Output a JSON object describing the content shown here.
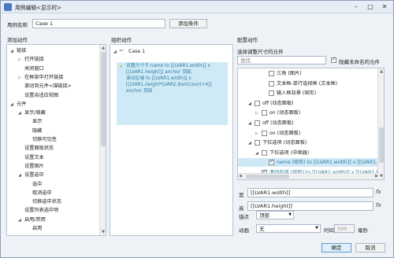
{
  "window": {
    "title": "用例编辑<显示时>",
    "min_glyph": "–",
    "max_glyph": "□",
    "close_glyph": "✕"
  },
  "top": {
    "case_name_label": "用例名称",
    "case_name_value": "Case 1",
    "add_condition_label": "添加条件"
  },
  "left": {
    "title": "添加动作",
    "items": [
      {
        "label": "链接",
        "indent": 0,
        "twisty": "◢"
      },
      {
        "label": "打开链接",
        "indent": 1,
        "twisty": "▷"
      },
      {
        "label": "关闭窗口",
        "indent": 1,
        "twisty": ""
      },
      {
        "label": "在框架中打开链接",
        "indent": 1,
        "twisty": "▷"
      },
      {
        "label": "滚动到元件<锚链接>",
        "indent": 1,
        "twisty": ""
      },
      {
        "label": "设置自适应视图",
        "indent": 1,
        "twisty": ""
      },
      {
        "label": "元件",
        "indent": 0,
        "twisty": "◢"
      },
      {
        "label": "显示/隐藏",
        "indent": 1,
        "twisty": "◢"
      },
      {
        "label": "显示",
        "indent": 2,
        "twisty": ""
      },
      {
        "label": "隐藏",
        "indent": 2,
        "twisty": ""
      },
      {
        "label": "切换可见性",
        "indent": 2,
        "twisty": ""
      },
      {
        "label": "设置面板状态",
        "indent": 1,
        "twisty": ""
      },
      {
        "label": "设置文本",
        "indent": 1,
        "twisty": ""
      },
      {
        "label": "设置图片",
        "indent": 1,
        "twisty": ""
      },
      {
        "label": "设置选中",
        "indent": 1,
        "twisty": "◢"
      },
      {
        "label": "选中",
        "indent": 2,
        "twisty": ""
      },
      {
        "label": "取消选中",
        "indent": 2,
        "twisty": ""
      },
      {
        "label": "切换选中状态",
        "indent": 2,
        "twisty": ""
      },
      {
        "label": "设置列表选中项",
        "indent": 1,
        "twisty": ""
      },
      {
        "label": "启用/禁用",
        "indent": 1,
        "twisty": "◢"
      },
      {
        "label": "启用",
        "indent": 2,
        "twisty": ""
      }
    ]
  },
  "middle": {
    "title": "组织动作",
    "case_label": "Case 1",
    "action_lines": [
      "设置尺寸于 name to [[LVAR1.width]] x",
      "[[LVAR1.height]] anchor 顶部,",
      "滚动区域 to [[LVAR1.width]] x",
      "[[LVAR1.height*LVAR2.itemCount+4]]",
      "anchor 顶部"
    ]
  },
  "right": {
    "title": "配置动作",
    "subtitle": "选择调整尺寸的元件",
    "search_placeholder": "查找",
    "hide_unnamed_label": "隐藏未命名的元件",
    "hide_unnamed_checked": true,
    "tree": [
      {
        "label": "三角 (图片)",
        "indent": 3,
        "twisty": "",
        "checked": false,
        "highlight": false
      },
      {
        "label": "文本框-单行选择框 (文本框)",
        "indent": 3,
        "twisty": "",
        "checked": false,
        "highlight": false
      },
      {
        "label": "输入框背景 (矩形)",
        "indent": 3,
        "twisty": "",
        "checked": false,
        "highlight": false
      },
      {
        "label": "off (动态面板)",
        "indent": 1,
        "twisty": "◢",
        "checked": false,
        "highlight": false
      },
      {
        "label": "on (动态面板)",
        "indent": 2,
        "twisty": "▷",
        "checked": false,
        "highlight": false
      },
      {
        "label": "off (动态面板)",
        "indent": 1,
        "twisty": "◢",
        "checked": false,
        "highlight": false
      },
      {
        "label": "on (动态面板)",
        "indent": 2,
        "twisty": "▷",
        "checked": false,
        "highlight": false
      },
      {
        "label": "下拉选项 (动态面板)",
        "indent": 1,
        "twisty": "◢",
        "checked": false,
        "highlight": false
      },
      {
        "label": "下拉选项 (中继器)",
        "indent": 2,
        "twisty": "◢",
        "checked": false,
        "highlight": false
      },
      {
        "label": "name (矩形) to [[LVAR1.width]] x [[LVAR1.height",
        "indent": 3,
        "twisty": "",
        "checked": true,
        "highlight": true
      },
      {
        "label": "滚动区域 (矩形) to [[LVAR1.width]] x [[LVAR1.height",
        "indent": 2,
        "twisty": "",
        "checked": true,
        "highlight": false
      }
    ],
    "width_label": "宽",
    "width_value": "[[LVAR1.width]]",
    "height_label": "高",
    "height_value": "[[LVAR1.height]]",
    "fx_label": "fx",
    "anchor_label": "锚点",
    "anchor_value": "顶部",
    "anim_label": "动画",
    "anim_value": "无",
    "time_label": "时间",
    "time_value": "500",
    "ms_label": "毫秒"
  },
  "footer": {
    "ok_label": "确定",
    "cancel_label": "取消"
  },
  "colors": {
    "action_text": "#2e7d9e",
    "selection": "#cfeaf7",
    "accent": "#5a9bd5"
  }
}
